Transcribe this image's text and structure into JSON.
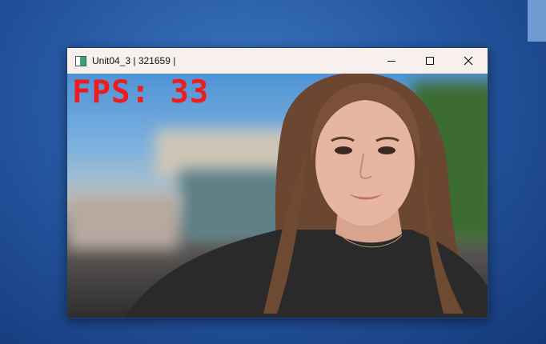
{
  "window": {
    "title": "Unit04_3 | 321659 |",
    "minimize_icon": "minimize-icon",
    "maximize_icon": "maximize-icon",
    "close_icon": "close-icon",
    "app_icon": "app-icon"
  },
  "overlay": {
    "fps_text": "FPS: 33"
  },
  "colors": {
    "desktop": "#2659a3",
    "titlebar": "#f7f0ec",
    "fps_text": "#ee1c1c"
  }
}
